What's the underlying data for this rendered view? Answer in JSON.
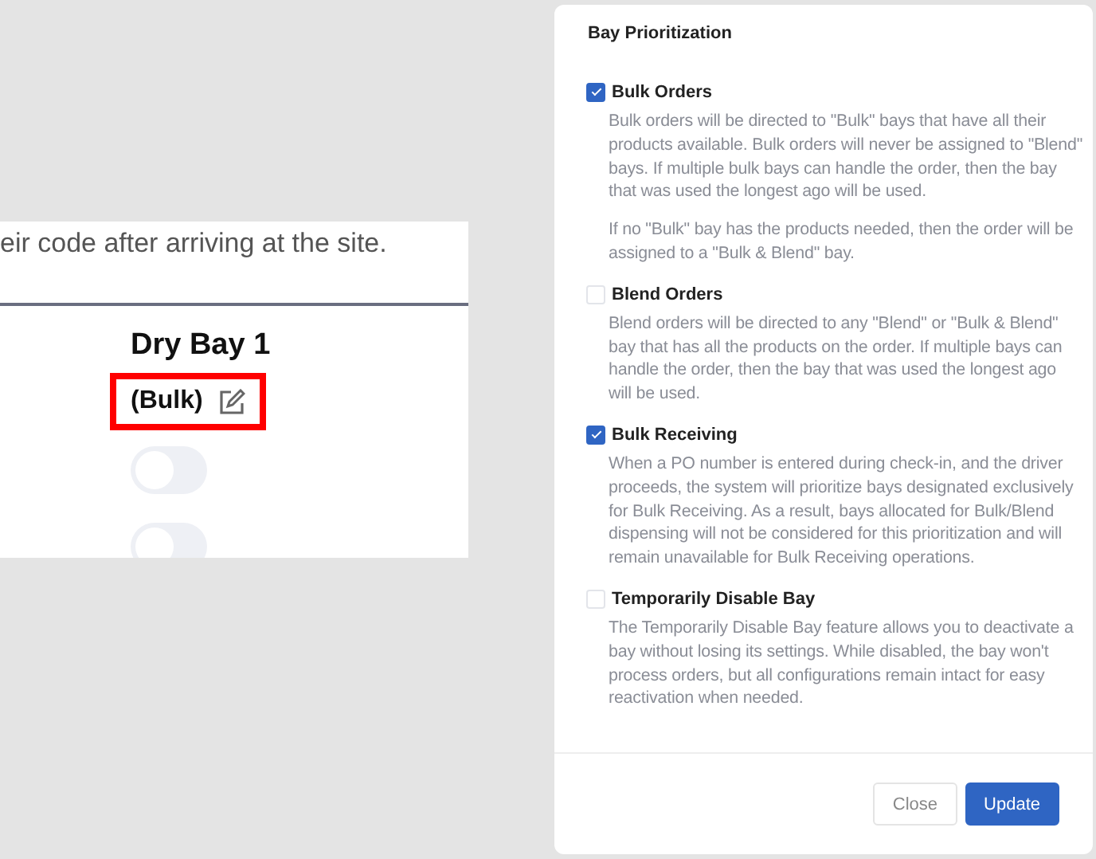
{
  "background_page": {
    "instruction_text": "eir code after arriving at the site.",
    "bay": {
      "name": "Dry Bay 1",
      "type_label": "(Bulk)",
      "highlighted": true
    },
    "toggles": [
      {
        "on": false
      },
      {
        "on": false
      }
    ]
  },
  "modal": {
    "title": "Bay Prioritization",
    "options": [
      {
        "label": "Bulk Orders",
        "checked": true,
        "description": [
          "Bulk orders will be directed to \"Bulk\" bays that have all their products available. Bulk orders will never be assigned to \"Blend\" bays. If multiple bulk bays can handle the order, then the bay that was used the longest ago will be used.",
          "If no \"Bulk\" bay has the products needed, then the order will be assigned to a \"Bulk & Blend\" bay."
        ]
      },
      {
        "label": "Blend Orders",
        "checked": false,
        "description": [
          "Blend orders will be directed to any \"Blend\" or \"Bulk & Blend\" bay that has all the products on the order. If multiple bays can handle the order, then the bay that was used the longest ago will be used."
        ]
      },
      {
        "label": "Bulk Receiving",
        "checked": true,
        "description": [
          "When a PO number is entered during check-in, and the driver proceeds, the system will prioritize bays designated exclusively for Bulk Receiving. As a result, bays allocated for Bulk/Blend dispensing will not be considered for this prioritization and will remain unavailable for Bulk Receiving operations."
        ]
      },
      {
        "label": "Temporarily Disable Bay",
        "checked": false,
        "description": [
          "The Temporarily Disable Bay feature allows you to deactivate a bay without losing its settings. While disabled, the bay won't process orders, but all configurations remain intact for easy reactivation when needed."
        ]
      }
    ],
    "buttons": [
      {
        "label": "Close",
        "kind": "secondary"
      },
      {
        "label": "Update",
        "kind": "primary"
      }
    ]
  }
}
